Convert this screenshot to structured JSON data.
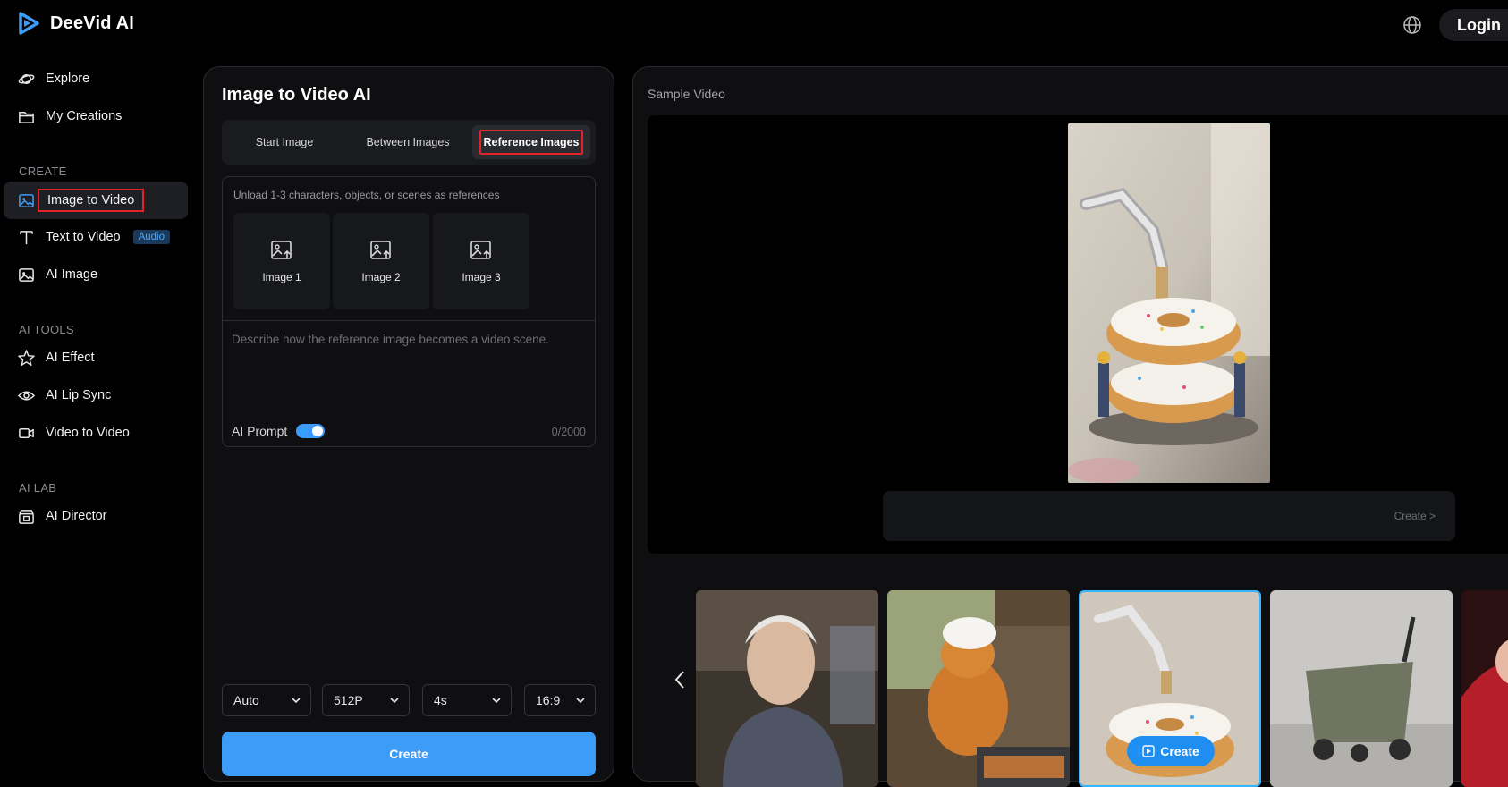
{
  "app": {
    "name": "DeeVid AI",
    "login_label": "Login"
  },
  "sidebar": {
    "top_items": [
      {
        "label": "Explore",
        "icon": "planet-icon"
      },
      {
        "label": "My Creations",
        "icon": "folder-icon"
      }
    ],
    "sections": [
      {
        "label": "CREATE"
      },
      {
        "label": "AI TOOLS"
      },
      {
        "label": "AI LAB"
      }
    ],
    "create_items": [
      {
        "label": "Image to Video",
        "icon": "image-icon",
        "active": true
      },
      {
        "label": "Text to Video",
        "icon": "text-icon",
        "badge": "Audio"
      },
      {
        "label": "AI Image",
        "icon": "ai-image-icon"
      }
    ],
    "tools_items": [
      {
        "label": "AI Effect",
        "icon": "sparkle-icon"
      },
      {
        "label": "AI Lip Sync",
        "icon": "eye-icon"
      },
      {
        "label": "Video to Video",
        "icon": "video-camera-icon"
      }
    ],
    "lab_items": [
      {
        "label": "AI Director",
        "icon": "clapperboard-icon"
      }
    ]
  },
  "panel": {
    "title": "Image to Video AI",
    "tabs": [
      "Start Image",
      "Between Images",
      "Reference Images"
    ],
    "active_tab": "Reference Images",
    "upload_hint": "Unload 1-3 characters, objects, or scenes as references",
    "slots": [
      "Image 1",
      "Image 2",
      "Image 3"
    ],
    "prompt_placeholder": "Describe how the reference image becomes a video scene.",
    "ai_prompt_label": "AI Prompt",
    "ai_prompt_enabled": true,
    "counter": "0/2000",
    "selects": {
      "model": "Auto",
      "resolution": "512P",
      "duration": "4s",
      "ratio": "16:9"
    },
    "create_label": "Create"
  },
  "sample": {
    "title": "Sample Video",
    "create_link": "Create >",
    "thumb_create_label": "Create"
  },
  "colors": {
    "accent": "#3d9cf5",
    "highlight": "#e0242b",
    "selected_thumb": "#33b5ff"
  }
}
